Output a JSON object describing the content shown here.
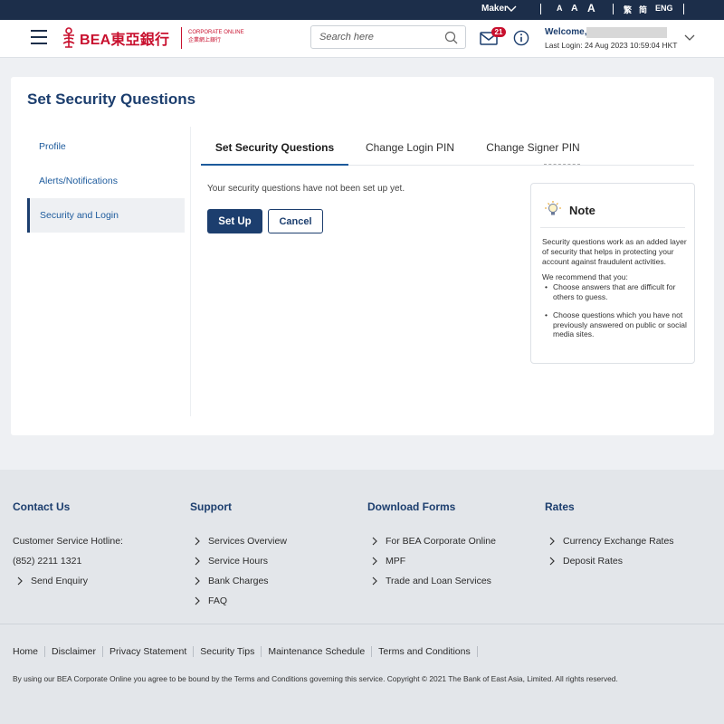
{
  "topbar": {
    "role": "Maker",
    "font_sizes": [
      "A",
      "A",
      "A"
    ],
    "languages": [
      "繁",
      "简",
      "ENG"
    ]
  },
  "header": {
    "logo_text": "BEA東亞銀行",
    "logo_sub_en": "CORPORATE ONLINE",
    "logo_sub_zh": "企業網上銀行",
    "search_placeholder": "Search here",
    "message_count": "21",
    "welcome": "Welcome,",
    "last_login": "Last Login: 24 Aug 2023 10:59:04 HKT"
  },
  "page": {
    "title": "Set Security Questions"
  },
  "sidebar": {
    "items": [
      {
        "label": "Profile"
      },
      {
        "label": "Alerts/Notifications"
      },
      {
        "label": "Security and Login"
      }
    ]
  },
  "tabs": [
    {
      "label": "Set Security Questions"
    },
    {
      "label": "Change Login PIN"
    },
    {
      "label": "Change Signer PIN"
    }
  ],
  "content": {
    "message": "Your security questions have not been set up yet.",
    "setup_label": "Set Up",
    "cancel_label": "Cancel"
  },
  "note": {
    "title": "Note",
    "intro": "Security questions work as an added layer of security that helps in protecting your account against fraudulent activities.",
    "recommend": "We recommend that you:",
    "bullets": [
      "Choose answers that are difficult for others to guess.",
      "Choose questions which you have not previously answered on public or social media sites."
    ]
  },
  "footer": {
    "contact": {
      "heading": "Contact Us",
      "hotline_label": "Customer Service Hotline:",
      "hotline_number": "(852) 2211 1321",
      "send_enquiry": "Send Enquiry"
    },
    "support": {
      "heading": "Support",
      "links": [
        "Services Overview",
        "Service Hours",
        "Bank Charges",
        "FAQ"
      ]
    },
    "forms": {
      "heading": "Download Forms",
      "links": [
        "For BEA Corporate Online",
        "MPF",
        "Trade and Loan Services"
      ]
    },
    "rates": {
      "heading": "Rates",
      "links": [
        "Currency Exchange Rates",
        "Deposit Rates"
      ]
    },
    "bottom_links": [
      "Home",
      "Disclaimer",
      "Privacy Statement",
      "Security Tips",
      "Maintenance Schedule",
      "Terms and Conditions"
    ],
    "copyright": "By using our BEA Corporate Online you agree to be bound by the Terms and Conditions governing this service. Copyright © 2021 The Bank of East Asia, Limited. All rights reserved."
  },
  "colors": {
    "brand_red": "#c8102e",
    "navy": "#1c3e6e",
    "topbar": "#1c2e4a",
    "link_blue": "#1c5a9c"
  }
}
